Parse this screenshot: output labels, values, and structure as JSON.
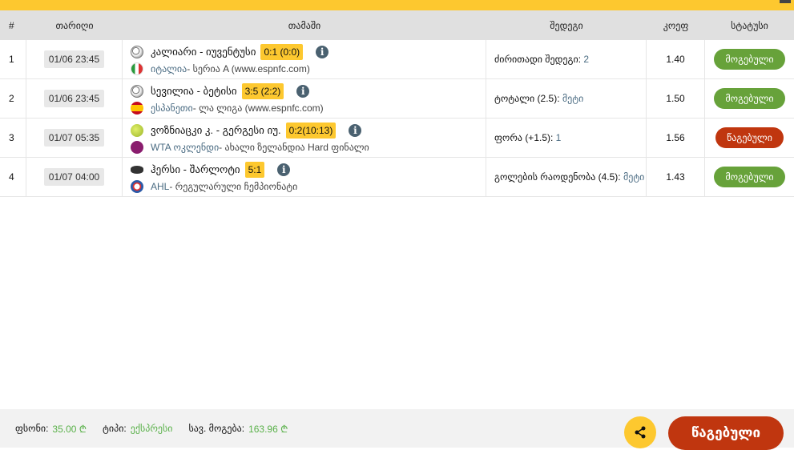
{
  "headers": {
    "num": "#",
    "date": "თარიღი",
    "game": "თამაში",
    "result": "შედეგი",
    "coef": "კოეფ",
    "status": "სტატუსი"
  },
  "rows": [
    {
      "num": "1",
      "date": "01/06 23:45",
      "sport_icon": "soccer-ball-icon",
      "teams": "კალიარი - იუვენტუსი",
      "score": "0:1 (0:0)",
      "flag_icon": "italy-flag-icon",
      "country": "იტალია",
      "league": " - სერია A (www.espnfc.com)",
      "market": "ძირითადი შედეგი: ",
      "pick": "2",
      "coef": "1.40",
      "status": "მოგებული",
      "status_type": "won"
    },
    {
      "num": "2",
      "date": "01/06 23:45",
      "sport_icon": "soccer-ball-icon",
      "teams": "სევილია - ბეტისი",
      "score": "3:5 (2:2)",
      "flag_icon": "spain-flag-icon",
      "country": "ესპანეთი",
      "league": " - ლა ლიგა (www.espnfc.com)",
      "market": "ტოტალი (2.5): ",
      "pick": "მეტი",
      "coef": "1.50",
      "status": "მოგებული",
      "status_type": "won"
    },
    {
      "num": "3",
      "date": "01/07 05:35",
      "sport_icon": "tennis-ball-icon",
      "teams": "ვოზნიაცკი კ. - გერგესი იუ.",
      "score": "0:2(10:13)",
      "flag_icon": "wta-logo-icon",
      "country": "WTA ოკლენდი",
      "league": " - ახალი ზელანდია Hard ფინალი",
      "market": "ფორა (+1.5): ",
      "pick": "1",
      "coef": "1.56",
      "status": "წაგებული",
      "status_type": "lost"
    },
    {
      "num": "4",
      "date": "01/07 04:00",
      "sport_icon": "hockey-puck-icon",
      "teams": "ჰერსი - შარლოტი",
      "score": "5:1",
      "flag_icon": "ahl-logo-icon",
      "country": "AHL",
      "league": " - რეგულარული ჩემპიონატი",
      "market": "გოლების რაოდენობა (4.5): ",
      "pick": "მეტი",
      "coef": "1.43",
      "status": "მოგებული",
      "status_type": "won"
    }
  ],
  "footer": {
    "stake_label": "ფსონი:",
    "stake": "35.00 ₾",
    "type_label": "ტიპი:",
    "type": "ექსპრესი",
    "win_label": "სავ. მოგება:",
    "win": "163.96 ₾",
    "result_button": "წაგებული"
  },
  "colors": {
    "accent": "#fdc82f",
    "won": "#67a23a",
    "lost": "#c0360f"
  }
}
